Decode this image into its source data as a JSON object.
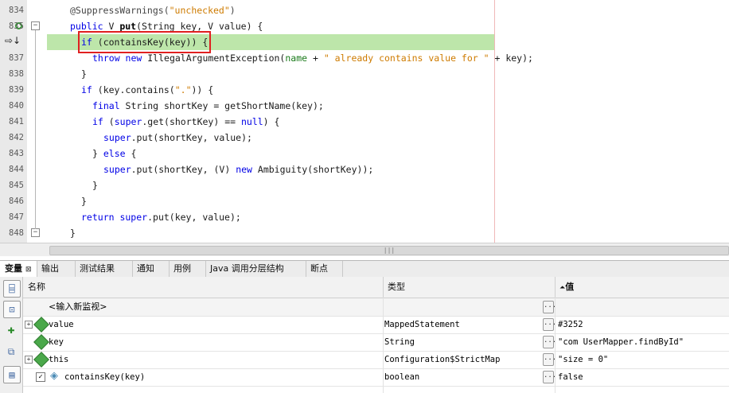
{
  "editor": {
    "lines": [
      {
        "num": "834",
        "segments": [
          [
            "ann",
            "@SuppressWarnings("
          ],
          [
            "str",
            "\"unchecked\""
          ],
          [
            "ann",
            ")"
          ]
        ],
        "indent": 0
      },
      {
        "num": "835",
        "segments": [
          [
            "kw",
            "public "
          ],
          [
            "",
            "V "
          ],
          [
            "fn",
            "put"
          ],
          [
            "",
            "(String key, V value) {"
          ]
        ],
        "indent": 0
      },
      {
        "num": "",
        "segments": [
          [
            "kw",
            "if "
          ],
          [
            "",
            "(containsKey(key)) {"
          ]
        ],
        "indent": 2
      },
      {
        "num": "837",
        "segments": [
          [
            "kw",
            "throw new "
          ],
          [
            "",
            "IllegalArgumentException("
          ],
          [
            "arg",
            "name"
          ],
          [
            "",
            " + "
          ],
          [
            "str",
            "\" already contains value for \""
          ],
          [
            "",
            " + key);"
          ]
        ],
        "indent": 4
      },
      {
        "num": "838",
        "segments": [
          [
            "",
            "}"
          ]
        ],
        "indent": 2
      },
      {
        "num": "839",
        "segments": [
          [
            "kw",
            "if "
          ],
          [
            "",
            "(key.contains("
          ],
          [
            "str",
            "\".\""
          ],
          [
            "",
            ")) {"
          ]
        ],
        "indent": 2
      },
      {
        "num": "840",
        "segments": [
          [
            "kw",
            "final "
          ],
          [
            "",
            "String shortKey = getShortName(key);"
          ]
        ],
        "indent": 4
      },
      {
        "num": "841",
        "segments": [
          [
            "kw",
            "if "
          ],
          [
            "",
            "("
          ],
          [
            "kw",
            "super"
          ],
          [
            "",
            ".get(shortKey) == "
          ],
          [
            "kw",
            "null"
          ],
          [
            "",
            ") {"
          ]
        ],
        "indent": 4
      },
      {
        "num": "842",
        "segments": [
          [
            "kw",
            "super"
          ],
          [
            "",
            ".put(shortKey, value);"
          ]
        ],
        "indent": 6
      },
      {
        "num": "843",
        "segments": [
          [
            "",
            "} "
          ],
          [
            "kw",
            "else "
          ],
          [
            "",
            "{"
          ]
        ],
        "indent": 4
      },
      {
        "num": "844",
        "segments": [
          [
            "kw",
            "super"
          ],
          [
            "",
            ".put(shortKey, (V) "
          ],
          [
            "kw",
            "new "
          ],
          [
            "",
            "Ambiguity(shortKey));"
          ]
        ],
        "indent": 6
      },
      {
        "num": "845",
        "segments": [
          [
            "",
            "}"
          ]
        ],
        "indent": 4
      },
      {
        "num": "846",
        "segments": [
          [
            "",
            "}"
          ]
        ],
        "indent": 2
      },
      {
        "num": "847",
        "segments": [
          [
            "kw",
            "return super"
          ],
          [
            "",
            ".put(key, value);"
          ]
        ],
        "indent": 2
      },
      {
        "num": "848",
        "segments": [
          [
            "",
            "}"
          ]
        ],
        "indent": 0
      }
    ],
    "scroll_grip": "|||"
  },
  "tabs": [
    {
      "label": "变量",
      "close": "⊠",
      "active": true
    },
    {
      "label": "输出"
    },
    {
      "label": "测试结果"
    },
    {
      "label": "通知"
    },
    {
      "label": "用例"
    },
    {
      "label": "Java 调用分层结构"
    },
    {
      "label": "断点"
    }
  ],
  "variables": {
    "headers": {
      "name": "名称",
      "type": "类型",
      "value": "值",
      "sort_indicator": "⏶"
    },
    "rows": [
      {
        "name": "<输入新监视>",
        "type": "",
        "value": "",
        "expandable": false,
        "icon": "none",
        "checkbox": false
      },
      {
        "name": "value",
        "type": "MappedStatement",
        "value": "#3252",
        "expandable": true,
        "icon": "field-icon",
        "checkbox": false
      },
      {
        "name": "key",
        "type": "String",
        "value": "\"com                 UserMapper.findById\"",
        "expandable": false,
        "icon": "field-icon",
        "checkbox": false
      },
      {
        "name": "this",
        "type": "Configuration$StrictMap",
        "value": "\"size = 0\"",
        "expandable": true,
        "icon": "field-icon",
        "checkbox": false
      },
      {
        "name": "containsKey(key)",
        "type": "boolean",
        "value": "false",
        "expandable": false,
        "icon": "watch-icon",
        "checkbox": true
      }
    ],
    "ellipsis": "..."
  }
}
